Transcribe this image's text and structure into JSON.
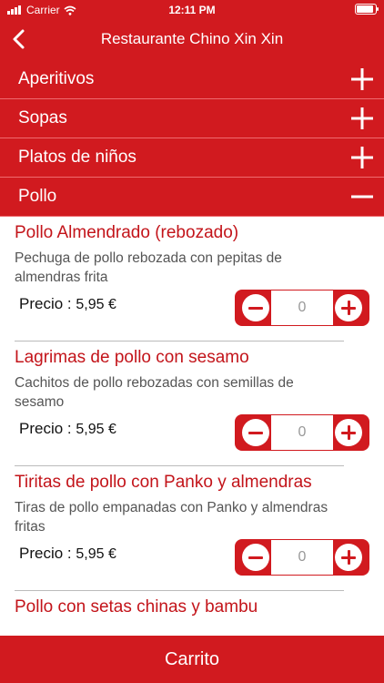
{
  "status_bar": {
    "carrier": "Carrier",
    "time": "12:11 PM"
  },
  "nav": {
    "title": "Restaurante Chino Xin Xin"
  },
  "sections": [
    {
      "label": "Aperitivos",
      "icon": "plus-icon"
    },
    {
      "label": "Sopas",
      "icon": "plus-icon"
    },
    {
      "label": "Platos de niños",
      "icon": "plus-icon"
    },
    {
      "label": "Pollo",
      "icon": "minus-icon"
    }
  ],
  "items": [
    {
      "name": "Pollo Almendrado (rebozado)",
      "description": "Pechuga de pollo rebozada con pepitas de almendras frita",
      "price_label": "Precio :",
      "price": "5,95 €",
      "quantity": "0"
    },
    {
      "name": "Lagrimas de pollo con sesamo",
      "description": "Cachitos de pollo rebozadas con semillas de sesamo",
      "price_label": "Precio :",
      "price": "5,95 €",
      "quantity": "0"
    },
    {
      "name": "Tiritas de pollo con Panko y almendras",
      "description": "Tiras de pollo empanadas con Panko y almendras fritas",
      "price_label": "Precio :",
      "price": "5,95 €",
      "quantity": "0"
    },
    {
      "name": "Pollo con setas chinas y bambu",
      "description": "",
      "price_label": "",
      "price": "",
      "quantity": ""
    }
  ],
  "cart": {
    "label": "Carrito"
  },
  "colors": {
    "primary": "#d11a1f",
    "title_red": "#c3141a"
  }
}
